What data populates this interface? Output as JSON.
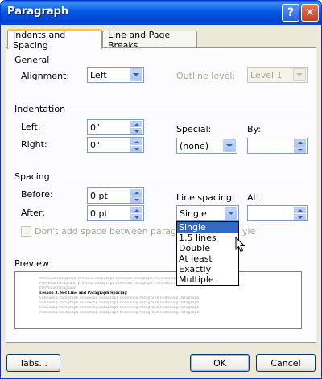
{
  "window": {
    "title": "Paragraph"
  },
  "titlebar": {
    "help_glyph": "?",
    "close_glyph": "✕"
  },
  "tabs": [
    {
      "label": "Indents and Spacing",
      "active": true
    },
    {
      "label": "Line and Page Breaks",
      "active": false
    }
  ],
  "general": {
    "heading": "General",
    "alignment_label": "Alignment:",
    "alignment_value": "Left",
    "outline_label": "Outline level:",
    "outline_value": "Level 1"
  },
  "indentation": {
    "heading": "Indentation",
    "left_label": "Left:",
    "left_value": "0\"",
    "right_label": "Right:",
    "right_value": "0\"",
    "special_label": "Special:",
    "special_value": "(none)",
    "by_label": "By:",
    "by_value": ""
  },
  "spacing": {
    "heading": "Spacing",
    "before_label": "Before:",
    "before_value": "0 pt",
    "after_label": "After:",
    "after_value": "0 pt",
    "line_spacing_label": "Line spacing:",
    "line_spacing_value": "Single",
    "at_label": "At:",
    "at_value": "",
    "dont_add_label": "Don't add space between paragraph",
    "dont_add_tail": "yle",
    "line_spacing_options": [
      "Single",
      "1.5 lines",
      "Double",
      "At least",
      "Exactly",
      "Multiple"
    ]
  },
  "preview": {
    "heading": "Preview",
    "lines_before": [
      "Previous Paragraph Previous Paragraph Previous Paragraph Previous Paragraph Previous Paragraph",
      "Previous Paragraph Previous Paragraph Previous Paragraph Previous Paragraph Previous Paragraph",
      "Previous Paragraph"
    ],
    "current_line": "Lesson 3. Set Line and Paragraph Spacing",
    "lines_after": [
      "Following Paragraph Following Paragraph Following Paragraph Following Paragraph",
      "Following Paragraph Following Paragraph Following Paragraph Following Paragraph",
      "Following Paragraph Following Paragraph Following Paragraph Following Paragraph",
      "Following Paragraph Following Paragraph Following Paragraph Following Paragraph"
    ]
  },
  "buttons": {
    "tabs": "Tabs...",
    "ok": "OK",
    "cancel": "Cancel"
  }
}
